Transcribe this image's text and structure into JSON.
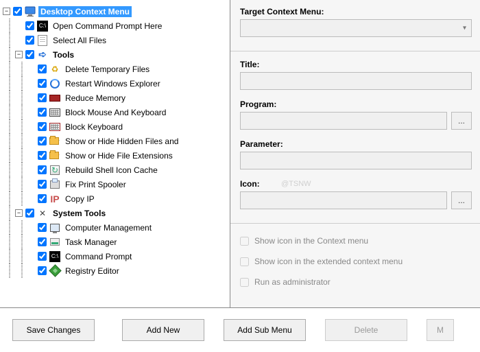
{
  "tree": {
    "root": {
      "label": "Desktop Context Menu",
      "children": [
        {
          "label": "Open Command Prompt Here",
          "icon": "cmd"
        },
        {
          "label": "Select All Files",
          "icon": "doc"
        }
      ]
    },
    "tools_label": "Tools",
    "tools": [
      {
        "label": "Delete Temporary Files",
        "icon": "recycle"
      },
      {
        "label": "Restart Windows Explorer",
        "icon": "ie"
      },
      {
        "label": "Reduce Memory",
        "icon": "ram"
      },
      {
        "label": "Block Mouse And Keyboard",
        "icon": "kbd"
      },
      {
        "label": "Block Keyboard",
        "icon": "kbd-red"
      },
      {
        "label": "Show or Hide Hidden Files and",
        "icon": "eye-green"
      },
      {
        "label": "Show or Hide File Extensions",
        "icon": "eye-orange"
      },
      {
        "label": "Rebuild Shell Icon Cache",
        "icon": "cache"
      },
      {
        "label": "Fix Print Spooler",
        "icon": "printer"
      },
      {
        "label": "Copy IP",
        "icon": "pipe"
      }
    ],
    "system_label": "System Tools",
    "system": [
      {
        "label": "Computer Management",
        "icon": "pc"
      },
      {
        "label": "Task Manager",
        "icon": "task"
      },
      {
        "label": "Command Prompt",
        "icon": "cmd"
      },
      {
        "label": "Registry Editor",
        "icon": "reg"
      }
    ]
  },
  "form": {
    "target_label": "Target Context Menu:",
    "title_label": "Title:",
    "program_label": "Program:",
    "parameter_label": "Parameter:",
    "icon_label": "Icon:",
    "browse": "...",
    "show_icon_ctx": "Show icon in the Context menu",
    "show_icon_ext": "Show icon in the extended context menu",
    "run_admin": "Run as administrator",
    "target_value": "",
    "title_value": "",
    "program_value": "",
    "parameter_value": "",
    "icon_value": ""
  },
  "buttons": {
    "save": "Save Changes",
    "add_new": "Add New",
    "add_sub": "Add Sub Menu",
    "delete": "Delete",
    "more": "M"
  },
  "watermark": {
    "main": "",
    "sub": "@TSNW"
  }
}
